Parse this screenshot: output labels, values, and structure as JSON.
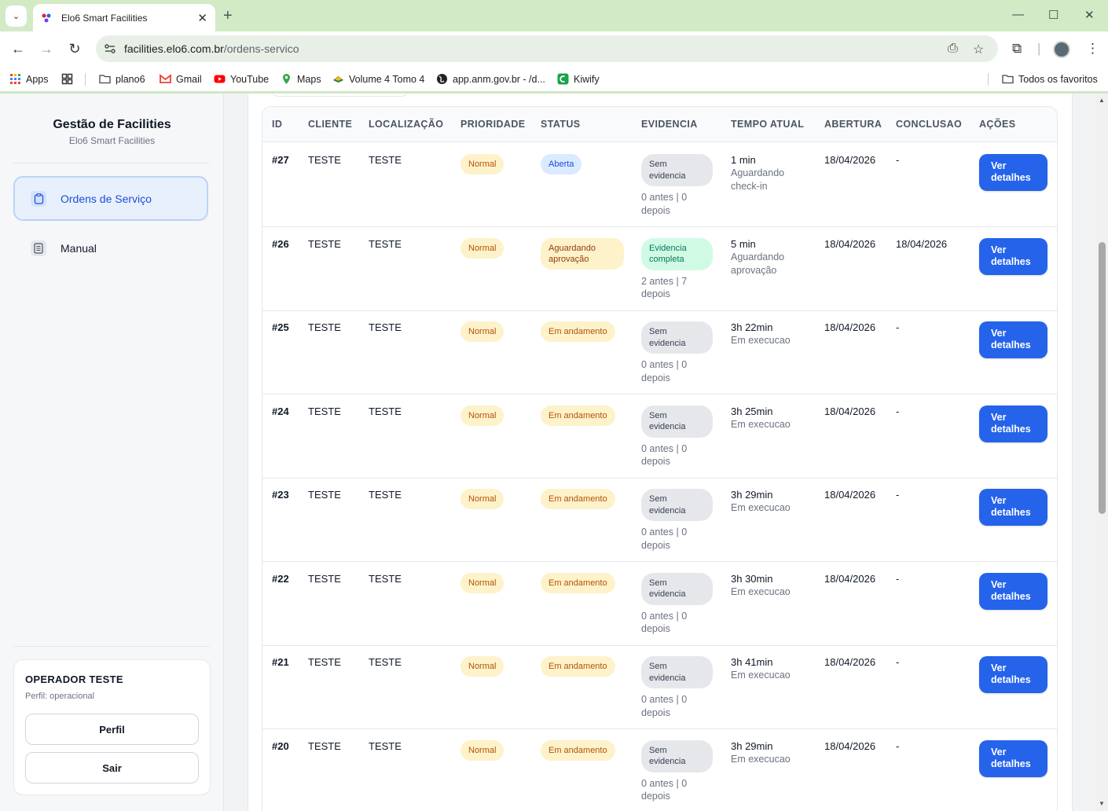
{
  "browser": {
    "tab_title": "Elo6 Smart Facilities",
    "url_host": "facilities.elo6.com.br",
    "url_path": "/ordens-servico",
    "bookmarks": [
      {
        "label": "Apps",
        "icon": "apps-grid-icon"
      },
      {
        "label": "plano6",
        "icon": "folder-icon"
      },
      {
        "label": "Gmail",
        "icon": "gmail-icon"
      },
      {
        "label": "YouTube",
        "icon": "youtube-icon"
      },
      {
        "label": "Maps",
        "icon": "maps-icon"
      },
      {
        "label": "Volume 4 Tomo 4",
        "icon": "volume-icon"
      },
      {
        "label": "app.anm.gov.br - /d...",
        "icon": "globe-icon"
      },
      {
        "label": "Kiwify",
        "icon": "kiwify-icon"
      }
    ],
    "all_bookmarks": "Todos os favoritos"
  },
  "sidebar": {
    "title": "Gestão de Facilities",
    "subtitle": "Elo6 Smart Facilities",
    "nav": [
      {
        "label": "Ordens de Serviço",
        "active": true
      },
      {
        "label": "Manual",
        "active": false
      }
    ],
    "user": {
      "name": "OPERADOR TESTE",
      "role": "Perfil: operacional",
      "profile_button": "Perfil",
      "logout_button": "Sair"
    }
  },
  "table": {
    "headers": [
      "ID",
      "CLIENTE",
      "LOCALIZAÇÃO",
      "PRIORIDADE",
      "STATUS",
      "EVIDENCIA",
      "TEMPO ATUAL",
      "ABERTURA",
      "CONCLUSAO",
      "AÇÕES"
    ],
    "action_label": "Ver detalhes",
    "rows": [
      {
        "id": "#27",
        "cliente": "TESTE",
        "local": "TESTE",
        "prioridade": "Normal",
        "status": "Aberta",
        "status_kind": "open",
        "evidencia": "Sem evidencia",
        "ev_kind": "none",
        "ev_count": "0 antes | 0 depois",
        "tempo": "1 min",
        "tempo_sub": "Aguardando check-in",
        "abertura": "18/04/2026",
        "conclusao": "-"
      },
      {
        "id": "#26",
        "cliente": "TESTE",
        "local": "TESTE",
        "prioridade": "Normal",
        "status": "Aguardando aprovação",
        "status_kind": "await",
        "evidencia": "Evidencia completa",
        "ev_kind": "full",
        "ev_count": "2 antes | 7 depois",
        "tempo": "5 min",
        "tempo_sub": "Aguardando aprovação",
        "abertura": "18/04/2026",
        "conclusao": "18/04/2026"
      },
      {
        "id": "#25",
        "cliente": "TESTE",
        "local": "TESTE",
        "prioridade": "Normal",
        "status": "Em andamento",
        "status_kind": "progress",
        "evidencia": "Sem evidencia",
        "ev_kind": "none",
        "ev_count": "0 antes | 0 depois",
        "tempo": "3h 22min",
        "tempo_sub": "Em execucao",
        "abertura": "18/04/2026",
        "conclusao": "-"
      },
      {
        "id": "#24",
        "cliente": "TESTE",
        "local": "TESTE",
        "prioridade": "Normal",
        "status": "Em andamento",
        "status_kind": "progress",
        "evidencia": "Sem evidencia",
        "ev_kind": "none",
        "ev_count": "0 antes | 0 depois",
        "tempo": "3h 25min",
        "tempo_sub": "Em execucao",
        "abertura": "18/04/2026",
        "conclusao": "-"
      },
      {
        "id": "#23",
        "cliente": "TESTE",
        "local": "TESTE",
        "prioridade": "Normal",
        "status": "Em andamento",
        "status_kind": "progress",
        "evidencia": "Sem evidencia",
        "ev_kind": "none",
        "ev_count": "0 antes | 0 depois",
        "tempo": "3h 29min",
        "tempo_sub": "Em execucao",
        "abertura": "18/04/2026",
        "conclusao": "-"
      },
      {
        "id": "#22",
        "cliente": "TESTE",
        "local": "TESTE",
        "prioridade": "Normal",
        "status": "Em andamento",
        "status_kind": "progress",
        "evidencia": "Sem evidencia",
        "ev_kind": "none",
        "ev_count": "0 antes | 0 depois",
        "tempo": "3h 30min",
        "tempo_sub": "Em execucao",
        "abertura": "18/04/2026",
        "conclusao": "-"
      },
      {
        "id": "#21",
        "cliente": "TESTE",
        "local": "TESTE",
        "prioridade": "Normal",
        "status": "Em andamento",
        "status_kind": "progress",
        "evidencia": "Sem evidencia",
        "ev_kind": "none",
        "ev_count": "0 antes | 0 depois",
        "tempo": "3h 41min",
        "tempo_sub": "Em execucao",
        "abertura": "18/04/2026",
        "conclusao": "-"
      },
      {
        "id": "#20",
        "cliente": "TESTE",
        "local": "TESTE",
        "prioridade": "Normal",
        "status": "Em andamento",
        "status_kind": "progress",
        "evidencia": "Sem evidencia",
        "ev_kind": "none",
        "ev_count": "0 antes | 0 depois",
        "tempo": "3h 29min",
        "tempo_sub": "Em execucao",
        "abertura": "18/04/2026",
        "conclusao": "-"
      }
    ]
  },
  "colors": {
    "primary": "#2563eb",
    "priority_bg": "#fdf2c9",
    "open_bg": "#dbeafe",
    "evidence_complete_bg": "#d1fae5",
    "evidence_none_bg": "#e5e7eb",
    "browser_frame": "#d3eac6"
  }
}
